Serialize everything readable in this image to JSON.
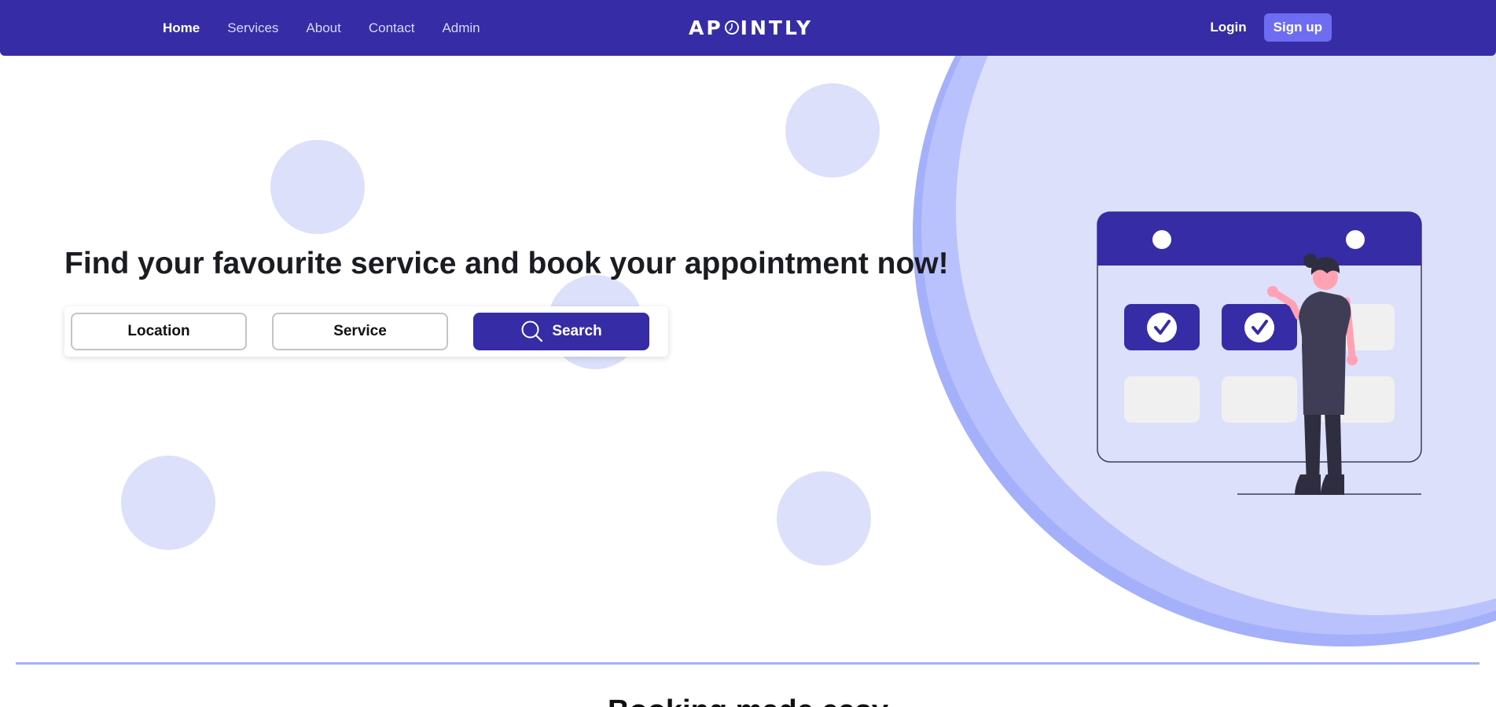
{
  "nav": {
    "links": [
      "Home",
      "Services",
      "About",
      "Contact",
      "Admin"
    ],
    "active": "Home",
    "logo_left": "AP",
    "logo_right": "INTLY",
    "login_label": "Login",
    "signup_label": "Sign up"
  },
  "hero": {
    "title": "Find your favourite service and book your appointment now!",
    "location_label": "Location",
    "service_label": "Service",
    "search_label": "Search"
  },
  "next_section": {
    "heading": "Booking made easy"
  },
  "colors": {
    "primary": "#352ca6",
    "accent_button": "#6e6cf0",
    "bubble": "#dde0fb",
    "circle_edge": "#a5b0fa"
  }
}
